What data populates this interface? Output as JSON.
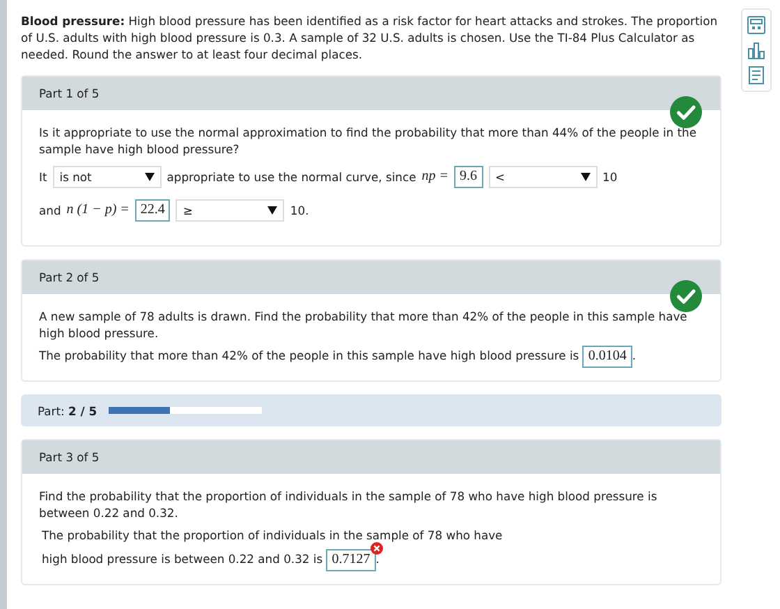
{
  "intro": {
    "label": "Blood pressure:",
    "text": "High blood pressure has been identified as a risk factor for heart attacks and strokes. The proportion of U.S. adults with high blood pressure is 0.3. A sample of 32 U.S. adults is chosen. Use the TI-84 Plus Calculator as needed. Round the answer to at least four decimal places."
  },
  "parts": [
    {
      "kind": "dropdowns",
      "header": "Part 1 of 5",
      "correct": true,
      "question": "Is it appropriate to use the normal approximation to find the probability that more than 44% of the people in the sample have high blood pressure?",
      "lines": [
        [
          {
            "kind": "text",
            "text": "It"
          },
          {
            "kind": "select",
            "value": "is not"
          },
          {
            "kind": "text",
            "text": "appropriate to use the normal curve, since"
          },
          {
            "kind": "math",
            "text": "np ="
          },
          {
            "kind": "box",
            "value": "9.6"
          },
          {
            "kind": "select",
            "value": "<"
          },
          {
            "kind": "text",
            "text": "10"
          }
        ],
        [
          {
            "kind": "text",
            "text": "and"
          },
          {
            "kind": "math",
            "text": "n (1 − p) ="
          },
          {
            "kind": "box",
            "value": "22.4"
          },
          {
            "kind": "select",
            "value": "≥"
          },
          {
            "kind": "text",
            "text": "10."
          }
        ]
      ]
    },
    {
      "kind": "answer",
      "header": "Part 2 of 5",
      "correct": true,
      "question": "A new sample of 78 adults is drawn. Find the probability that more than 42% of the people in this sample have high blood pressure.",
      "prompt": [
        "The probability that more than 42% of the people in this sample have high blood pressure is"
      ],
      "value": "0.0104",
      "wrong": false,
      "end": "."
    },
    {
      "kind": "progress",
      "label": "Part:",
      "value": "2 / 5",
      "level": 0.4
    },
    {
      "kind": "answer",
      "header": "Part 3 of 5",
      "correct": false,
      "question": "Find the probability that the proportion of individuals in the sample of 78 who have high blood pressure is between 0.22 and 0.32.",
      "prompt": [
        "The probability that the proportion of individuals in the sample of 78 who have",
        "high blood pressure is between 0.22 and 0.32 is"
      ],
      "value": "0.7127",
      "wrong": true,
      "end": "."
    }
  ]
}
